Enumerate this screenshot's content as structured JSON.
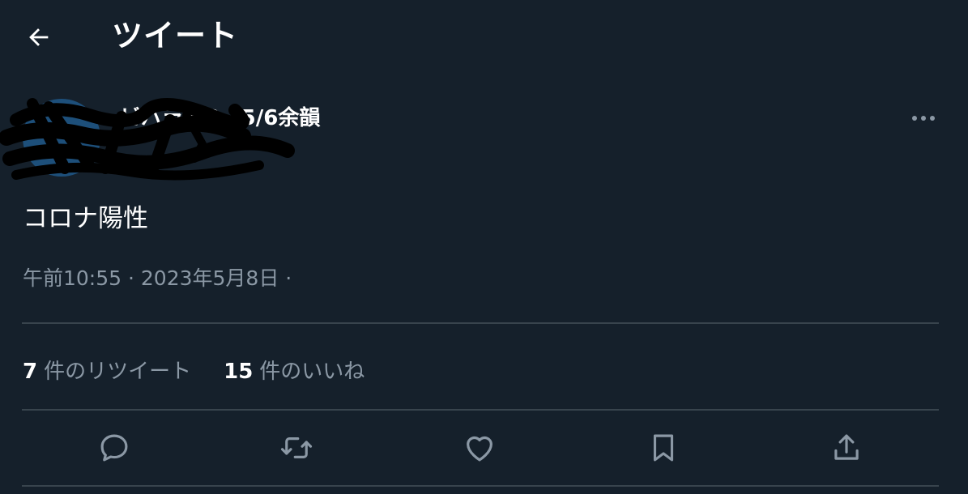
{
  "header": {
    "title": "ツイート",
    "back_icon": "arrow-left-icon"
  },
  "author": {
    "display_name": "ビバラ5/3、5/6余韻",
    "handle": "",
    "more_icon": "more-horizontal-icon"
  },
  "tweet": {
    "text": "コロナ陽性",
    "meta": "午前10:55 · 2023年5月8日 ·"
  },
  "stats": {
    "retweets": {
      "count": "7",
      "label": "件のリツイート"
    },
    "likes": {
      "count": "15",
      "label": "件のいいね"
    }
  },
  "actions": [
    {
      "icon": "reply-icon"
    },
    {
      "icon": "retweet-icon"
    },
    {
      "icon": "like-heart-icon"
    },
    {
      "icon": "bookmark-icon"
    },
    {
      "icon": "share-icon"
    }
  ],
  "colors": {
    "background": "#15202b",
    "text_primary": "#ffffff",
    "text_secondary": "#8b98a5",
    "divider": "#38444d"
  }
}
